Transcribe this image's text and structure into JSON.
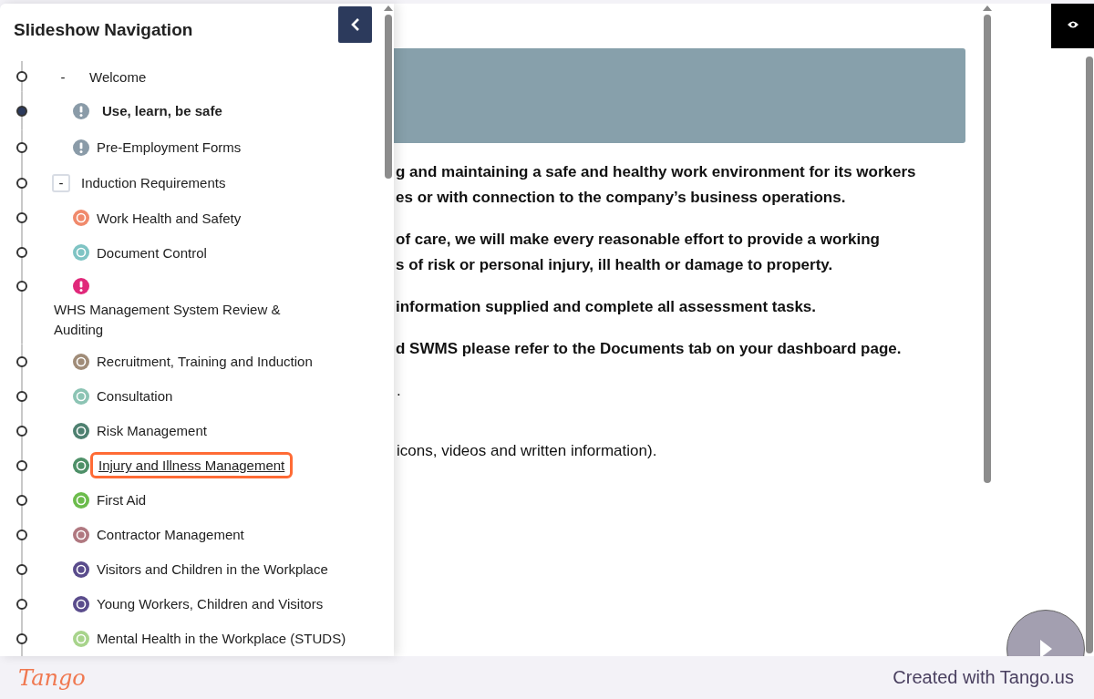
{
  "sidebar": {
    "title": "Slideshow Navigation",
    "items": [
      {
        "label": "Welcome",
        "toggle": "-",
        "toggle_boxed": false,
        "selected": false,
        "children": [
          {
            "label": "Use, learn, be safe",
            "kind": "alert",
            "color": "#8a9ba8",
            "selected": true,
            "highlighted": false
          },
          {
            "label": "Pre-Employment Forms",
            "kind": "alert",
            "color": "#8a9ba8",
            "selected": false,
            "highlighted": false
          }
        ]
      },
      {
        "label": "Induction Requirements",
        "toggle": "-",
        "toggle_boxed": true,
        "selected": false,
        "children": [
          {
            "label": "Work Health and Safety",
            "kind": "topic",
            "color": "#f08a6c",
            "selected": false,
            "highlighted": false
          },
          {
            "label": "Document Control",
            "kind": "topic",
            "color": "#7fc4c4",
            "selected": false,
            "highlighted": false
          },
          {
            "label": "WHS Management System Review & Auditing",
            "kind": "stacked-alert",
            "color": "#e0287a",
            "selected": false,
            "highlighted": false
          },
          {
            "label": "Recruitment, Training and Induction",
            "kind": "topic",
            "color": "#a08c78",
            "selected": false,
            "highlighted": false
          },
          {
            "label": "Consultation",
            "kind": "topic",
            "color": "#8cc4b4",
            "selected": false,
            "highlighted": false
          },
          {
            "label": "Risk Management",
            "kind": "topic",
            "color": "#4e8070",
            "selected": false,
            "highlighted": false
          },
          {
            "label": "Injury and Illness Management",
            "kind": "topic",
            "color": "#4e9068",
            "selected": false,
            "highlighted": true
          },
          {
            "label": "First Aid",
            "kind": "topic",
            "color": "#6cbc4c",
            "selected": false,
            "highlighted": false
          },
          {
            "label": "Contractor Management",
            "kind": "topic",
            "color": "#b07880",
            "selected": false,
            "highlighted": false
          },
          {
            "label": "Visitors and Children in the Workplace",
            "kind": "topic",
            "color": "#5a4c8c",
            "selected": false,
            "highlighted": false
          },
          {
            "label": "Young Workers, Children and Visitors",
            "kind": "topic",
            "color": "#5a4c8c",
            "selected": false,
            "highlighted": false
          },
          {
            "label": "Mental Health in the Workplace (STUDS)",
            "kind": "topic",
            "color": "#a8d48c",
            "selected": false,
            "highlighted": false
          }
        ]
      }
    ]
  },
  "content": {
    "paragraphs": [
      {
        "bold": true,
        "lines": [
          "g and maintaining a safe and healthy work environment for its workers",
          "es or with connection to the company’s business operations."
        ]
      },
      {
        "bold": true,
        "lines": [
          "of care, we will make every reasonable effort to provide a working",
          "s of risk or personal injury, ill health or damage to property."
        ]
      },
      {
        "bold": true,
        "lines": [
          "information supplied and complete all assessment tasks."
        ]
      },
      {
        "bold": true,
        "lines": [
          "d SWMS please refer to the Documents tab on your dashboard page."
        ]
      },
      {
        "bold": false,
        "lines": [
          "."
        ]
      },
      {
        "bold": false,
        "lines": [
          "icons, videos and written information)."
        ]
      }
    ]
  },
  "footer": {
    "logo": "Tango",
    "credit": "Created with Tango.us"
  }
}
